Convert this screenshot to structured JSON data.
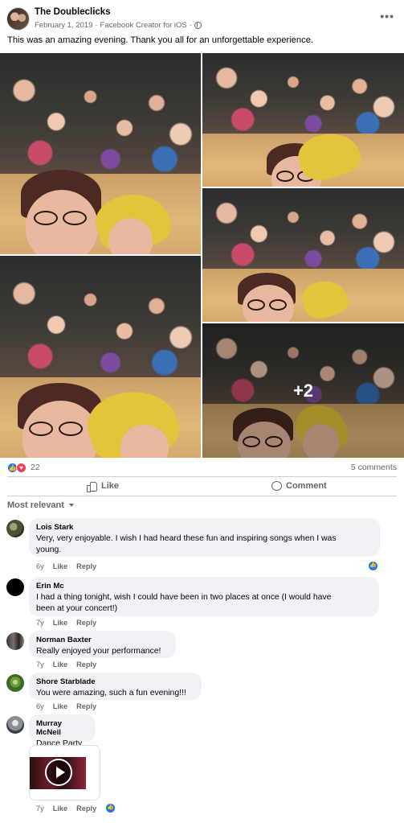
{
  "post": {
    "page_name": "The Doubleclicks",
    "date": "February 1, 2019",
    "meta_separator": "·",
    "app": "Facebook Creator for iOS",
    "more_icon": "more-horizontal-icon",
    "caption": "This was an amazing evening. Thank you all for an unforgettable experience.",
    "extra_photos": "+2"
  },
  "reactions": {
    "count": "22",
    "icons": [
      "like-icon",
      "love-icon"
    ],
    "comments": "5 comments"
  },
  "actions": {
    "like": "Like",
    "comment": "Comment"
  },
  "sort": {
    "label": "Most relevant"
  },
  "comments": [
    {
      "name": "Lois Stark",
      "line1": "Very, very enjoyable. I wish I had heard these fun and inspiring songs when I was",
      "line2": "young.",
      "age": "6y",
      "like": "Like",
      "reply": "Reply"
    },
    {
      "name": "Erin Mc",
      "line1": "I had a thing tonight, wish I could have been in two places at once (I would have",
      "line2": "been at your concert!)",
      "age": "7y",
      "like": "Like",
      "reply": "Reply"
    },
    {
      "name": "Norman Baxter",
      "line1": "Really enjoyed your performance!",
      "age": "7y",
      "like": "Like",
      "reply": "Reply"
    },
    {
      "name": "Shore Starblade",
      "line1": "You were amazing, such a fun evening!!!",
      "age": "6y",
      "like": "Like",
      "reply": "Reply"
    },
    {
      "name": "Murray McNeil",
      "line1": "Dance Party",
      "age": "7y",
      "like": "Like",
      "reply": "Reply"
    }
  ],
  "colors": {
    "accent": "#1877f2",
    "love": "#f33e58",
    "muted": "#65676b",
    "bubble": "#f0f2f5"
  }
}
